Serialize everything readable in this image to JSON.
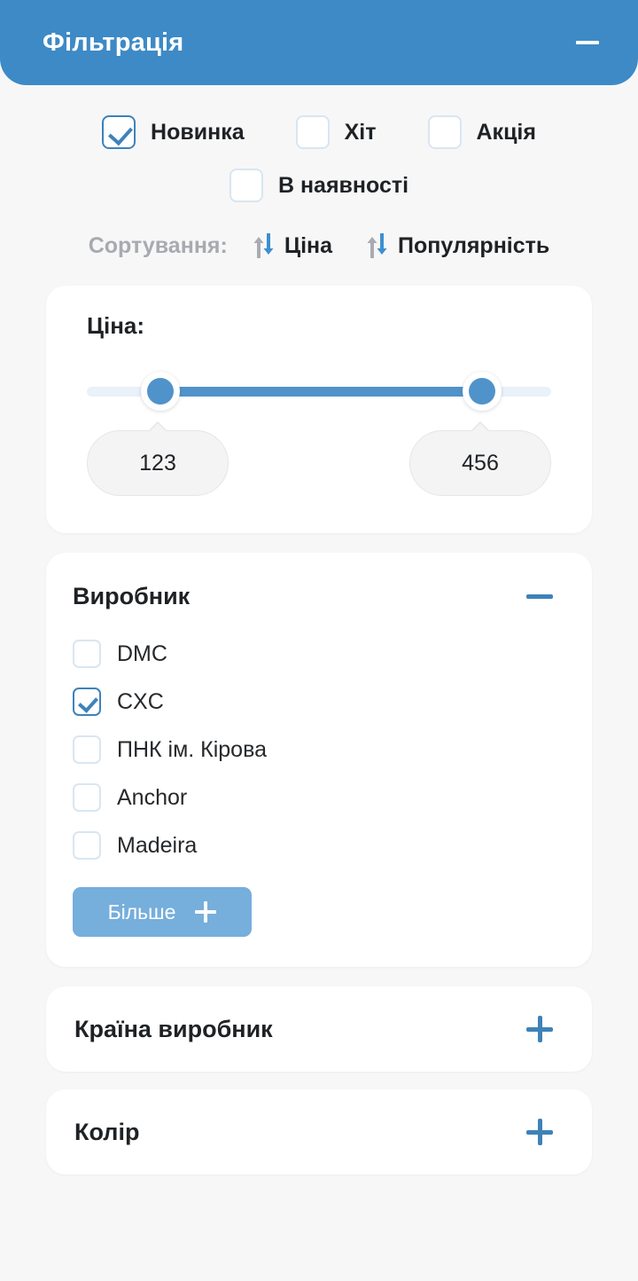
{
  "header": {
    "title": "Фільтрація",
    "collapse_icon": "minus-icon"
  },
  "flags": {
    "row1": [
      {
        "label": "Новинка",
        "checked": true
      },
      {
        "label": "Хіт",
        "checked": false
      },
      {
        "label": "Акція",
        "checked": false
      }
    ],
    "row2": [
      {
        "label": "В наявності",
        "checked": false
      }
    ]
  },
  "sorting": {
    "caption": "Сортування:",
    "options": [
      {
        "label": "Ціна",
        "icon": "sort-arrows-icon"
      },
      {
        "label": "Популярність",
        "icon": "sort-arrows-icon"
      }
    ]
  },
  "price": {
    "title": "Ціна:",
    "min_value": "123",
    "max_value": "456",
    "min_placeholder": "123",
    "max_placeholder": "456"
  },
  "manufacturer": {
    "title": "Виробник",
    "collapse_icon": "minus-icon",
    "options": [
      {
        "label": "DMC",
        "checked": false
      },
      {
        "label": "CXC",
        "checked": true
      },
      {
        "label": "ПНК ім. Кірова",
        "checked": false
      },
      {
        "label": "Anchor",
        "checked": false
      },
      {
        "label": "Madeira",
        "checked": false
      }
    ],
    "more_label": "Більше",
    "more_icon": "plus-icon"
  },
  "collapsed_sections": [
    {
      "title": "Країна виробник",
      "expand_icon": "plus-icon"
    },
    {
      "title": "Колір",
      "expand_icon": "plus-icon"
    }
  ],
  "colors": {
    "header_blue": "#3d8ac6",
    "accent_blue": "#3e82b8",
    "slider_blue": "#4f93ca",
    "button_blue": "#76aedc",
    "checkbox_border": "#d8e6f2",
    "page_background": "#f7f7f8",
    "card_background": "#ffffff",
    "text_dark": "#1f2225",
    "text_muted": "#a7abaf"
  }
}
